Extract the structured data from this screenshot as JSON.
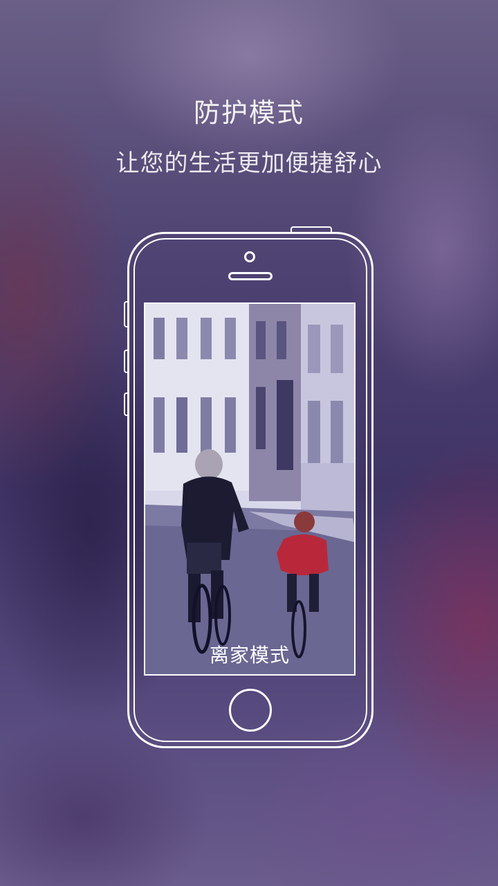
{
  "intro": {
    "title": "防护模式",
    "subtitle": "让您的生活更加便捷舒心"
  },
  "phone_screen": {
    "mode_label": "离家模式",
    "photo_subject": "adult-and-child-cycling-street-photo"
  },
  "colors": {
    "text": "#ffffff",
    "outline": "#ffffff",
    "background_tint": "#4e4272"
  }
}
